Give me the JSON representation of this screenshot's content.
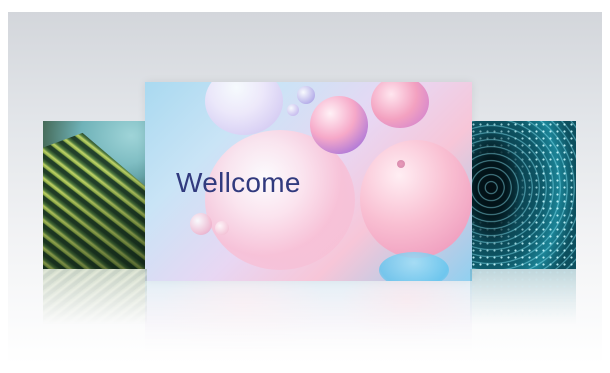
{
  "carousel": {
    "slides": [
      {
        "name": "palm-leaf-slide",
        "position": "left"
      },
      {
        "name": "welcome-slide",
        "position": "center",
        "title": "Wellcome"
      },
      {
        "name": "tunnel-slide",
        "position": "right"
      }
    ]
  },
  "colors": {
    "title_text": "#313a7e",
    "leaf_green": "#8fae45",
    "tunnel_cyan": "#1b8396",
    "bubble_pink": "#f6a8c8"
  }
}
